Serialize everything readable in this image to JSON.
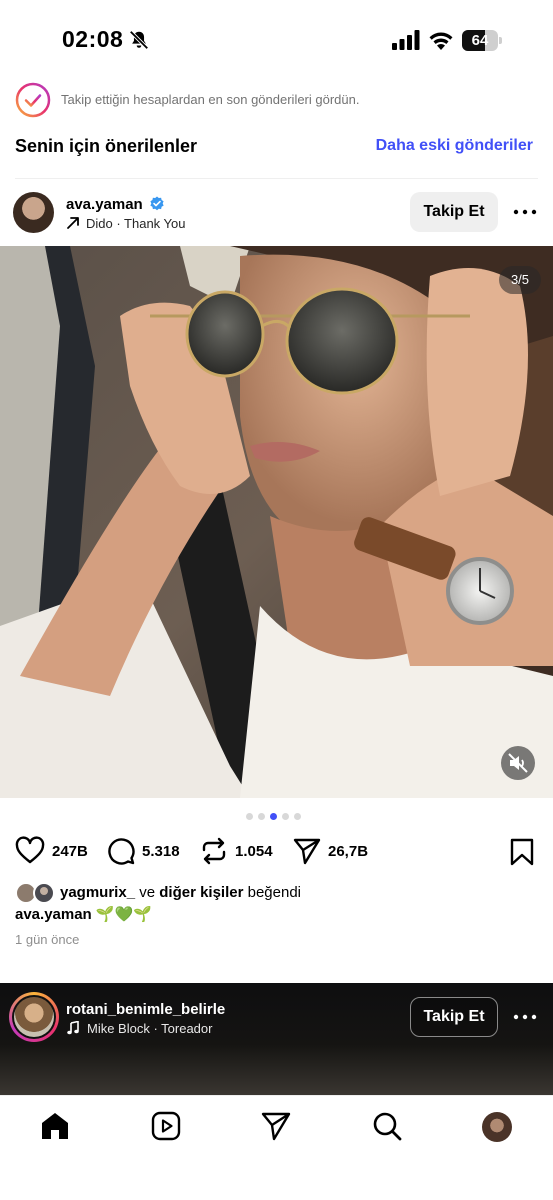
{
  "status_bar": {
    "time": "02:08",
    "battery": "64",
    "battery_level": 0.64
  },
  "feed": {
    "caught_up_text": "Takip ettiğin hesaplardan en son gönderileri gördün.",
    "suggested_title": "Senin için önerilenler",
    "older_posts_link": "Daha eski gönderiler"
  },
  "post": {
    "username": "ava.yaman",
    "music": "Dido · Thank You",
    "follow_label": "Takip Et",
    "carousel_counter": "3/5",
    "carousel_total": 5,
    "carousel_active_index": 2,
    "likes": "247B",
    "comments": "5.318",
    "reposts": "1.054",
    "shares": "26,7B",
    "liked_by_user": "yagmurix_",
    "liked_by_connector": "ve",
    "liked_by_others": "diğer kişiler",
    "liked_by_suffix": "beğendi",
    "caption_user": "ava.yaman",
    "caption_text": "🌱💚🌱",
    "time_ago": "1 gün önce"
  },
  "next_reel": {
    "username": "rotani_benimle_belirle",
    "music": "Mike Block · Toreador",
    "follow_label": "Takip Et"
  },
  "tab_bar": {
    "items": [
      "home-icon",
      "reels-icon",
      "direct-icon",
      "search-icon",
      "profile-avatar"
    ]
  },
  "colors": {
    "accent_link": "#4150f7",
    "verified": "#3897f0"
  }
}
